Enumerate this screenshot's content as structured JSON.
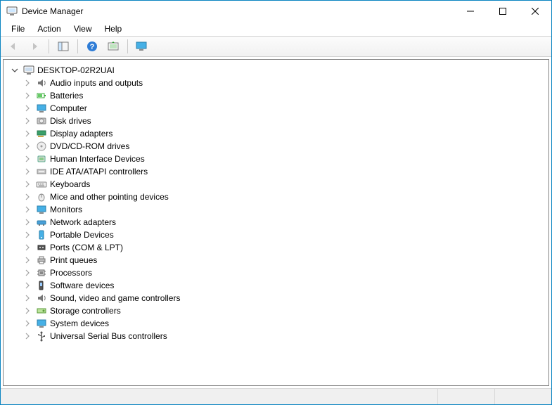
{
  "window": {
    "title": "Device Manager"
  },
  "menu": {
    "file": "File",
    "action": "Action",
    "view": "View",
    "help": "Help"
  },
  "toolbar": {
    "back": "Back",
    "forward": "Forward",
    "show_hide_tree": "Show/Hide Console Tree",
    "help": "Help",
    "scan": "Scan for hardware changes",
    "add_legacy": "Add legacy hardware"
  },
  "tree": {
    "root": {
      "label": "DESKTOP-02R2UAI",
      "icon": "computer-root-icon"
    },
    "items": [
      {
        "label": "Audio inputs and outputs",
        "icon": "audio-icon"
      },
      {
        "label": "Batteries",
        "icon": "battery-icon"
      },
      {
        "label": "Computer",
        "icon": "computer-icon"
      },
      {
        "label": "Disk drives",
        "icon": "disk-icon"
      },
      {
        "label": "Display adapters",
        "icon": "display-adapter-icon"
      },
      {
        "label": "DVD/CD-ROM drives",
        "icon": "dvd-icon"
      },
      {
        "label": "Human Interface Devices",
        "icon": "hid-icon"
      },
      {
        "label": "IDE ATA/ATAPI controllers",
        "icon": "ide-icon"
      },
      {
        "label": "Keyboards",
        "icon": "keyboard-icon"
      },
      {
        "label": "Mice and other pointing devices",
        "icon": "mouse-icon"
      },
      {
        "label": "Monitors",
        "icon": "monitor-icon"
      },
      {
        "label": "Network adapters",
        "icon": "network-icon"
      },
      {
        "label": "Portable Devices",
        "icon": "portable-icon"
      },
      {
        "label": "Ports (COM & LPT)",
        "icon": "port-icon"
      },
      {
        "label": "Print queues",
        "icon": "printer-icon"
      },
      {
        "label": "Processors",
        "icon": "cpu-icon"
      },
      {
        "label": "Software devices",
        "icon": "software-icon"
      },
      {
        "label": "Sound, video and game controllers",
        "icon": "sound-icon"
      },
      {
        "label": "Storage controllers",
        "icon": "storage-icon"
      },
      {
        "label": "System devices",
        "icon": "system-icon"
      },
      {
        "label": "Universal Serial Bus controllers",
        "icon": "usb-icon"
      }
    ]
  }
}
